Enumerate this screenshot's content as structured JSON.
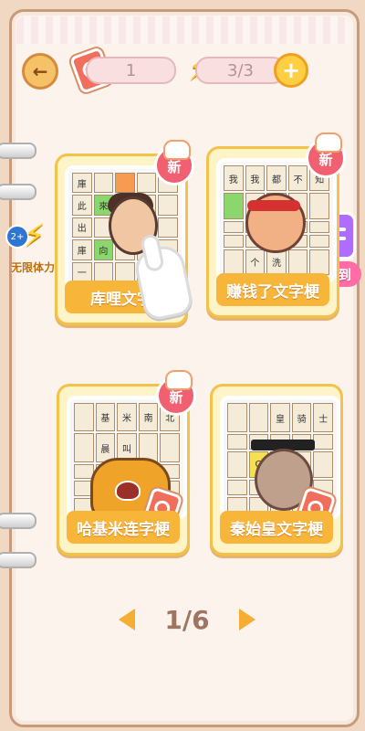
{
  "header": {
    "ticket_value": "1",
    "energy_value": "3/3"
  },
  "promotions": {
    "left_label": "无限体力",
    "left_badge": "2+"
  },
  "cards": [
    {
      "title": "库哩文字",
      "badge": "新",
      "grid_text": [
        "庫",
        "",
        "",
        "",
        "",
        "此",
        "來",
        "",
        "",
        "",
        "出",
        "",
        "",
        "",
        "",
        "庫",
        "向",
        "",
        "",
        "",
        "一",
        "",
        "",
        "",
        "",
        ""
      ]
    },
    {
      "title": "赚钱了文字梗",
      "badge": "新",
      "grid_text": [
        "我",
        "我",
        "都",
        "不",
        "知",
        "",
        "有",
        "",
        "",
        "",
        "",
        "",
        "",
        "",
        "",
        "",
        "",
        "",
        "",
        "",
        "",
        "个",
        "洗",
        "",
        ""
      ]
    },
    {
      "title": "哈基米连字梗",
      "badge": "新",
      "grid_text": [
        "",
        "基",
        "米",
        "南",
        "北",
        "",
        "晨",
        "叫",
        "",
        "",
        "",
        "",
        "",
        "",
        "",
        "",
        "",
        "",
        "",
        "",
        "",
        "",
        "",
        "",
        ""
      ]
    },
    {
      "title": "秦始皇文字梗",
      "badge": "",
      "grid_text": [
        "",
        "",
        "皇",
        "骑",
        "士",
        "",
        "",
        "",
        "",
        "",
        "",
        "G",
        "",
        "",
        "",
        "",
        "",
        "",
        "",
        "",
        "",
        "",
        "",
        "",
        ""
      ]
    }
  ],
  "checkin": {
    "label": "签到"
  },
  "pagination": {
    "current": "1/6"
  }
}
